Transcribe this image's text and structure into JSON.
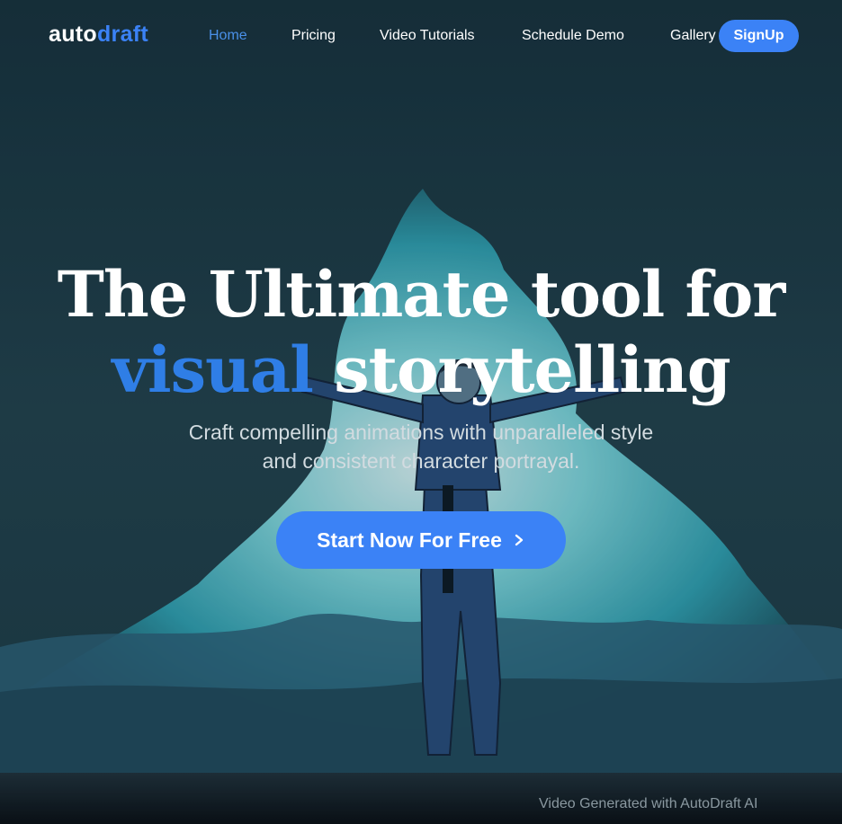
{
  "nav": {
    "logo_auto": "auto",
    "logo_draft": "draft",
    "links": [
      "Home",
      "Pricing",
      "Video Tutorials",
      "Schedule Demo",
      "Gallery"
    ],
    "active": "Home",
    "signup_label": "SignUp"
  },
  "hero": {
    "line1": "The Ultimate tool for",
    "line2_accent": "visual",
    "line2_rest": " storytelling",
    "sub_line1": "Craft compelling animations with unparalleled style",
    "sub_line2": "and consistent character portrayal.",
    "cta_label": "Start Now For Free",
    "cta_icon": "chevron-right-icon",
    "caption": "Video Generated with AutoDraft AI"
  },
  "colors": {
    "accent": "#3b82f6",
    "background": "#1b3a46",
    "text": "#ffffff"
  }
}
